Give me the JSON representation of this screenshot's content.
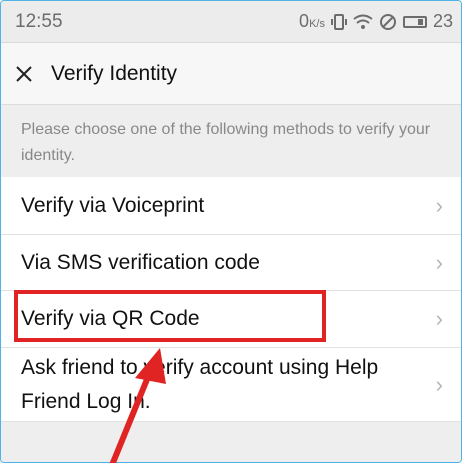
{
  "status_bar": {
    "time": "12:55",
    "network_speed": "0",
    "network_speed_unit": "K/s",
    "battery_level": "23"
  },
  "header": {
    "close_icon": "close-icon",
    "title": "Verify Identity"
  },
  "description": "Please choose one of the following methods to verify your identity.",
  "methods": [
    {
      "label": "Verify via Voiceprint"
    },
    {
      "label": "Via SMS verification code"
    },
    {
      "label": "Verify via QR Code"
    },
    {
      "label": "Ask friend to verify account using Help Friend Log In."
    }
  ],
  "annotation": {
    "highlight_color": "#e02424",
    "highlighted_item": "Verify via QR Code"
  },
  "colors": {
    "accent_border": "#4fb3e8",
    "background": "#eeeeee",
    "chevron": "#b5b5b5"
  }
}
